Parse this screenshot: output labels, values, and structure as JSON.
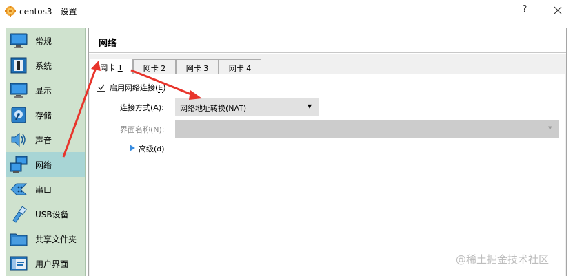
{
  "window": {
    "title": "centos3 - 设置",
    "help_label": "?",
    "app_icon": "virtualbox-gear-icon",
    "close_icon": "close-icon"
  },
  "sidebar": {
    "items": [
      {
        "label": "常规",
        "icon": "general-monitor-icon",
        "active": false
      },
      {
        "label": "系统",
        "icon": "system-chip-icon",
        "active": false
      },
      {
        "label": "显示",
        "icon": "display-monitor-icon",
        "active": false
      },
      {
        "label": "存储",
        "icon": "storage-disk-icon",
        "active": false
      },
      {
        "label": "声音",
        "icon": "speaker-icon",
        "active": false
      },
      {
        "label": "网络",
        "icon": "network-icon",
        "active": true
      },
      {
        "label": "串口",
        "icon": "serial-port-icon",
        "active": false
      },
      {
        "label": "USB设备",
        "icon": "usb-icon",
        "active": false
      },
      {
        "label": "共享文件夹",
        "icon": "shared-folder-icon",
        "active": false
      },
      {
        "label": "用户界面",
        "icon": "user-interface-icon",
        "active": false
      }
    ]
  },
  "main": {
    "title": "网络",
    "tabs": [
      {
        "label": "网卡",
        "num": "1",
        "active": true
      },
      {
        "label": "网卡",
        "num": "2",
        "active": false
      },
      {
        "label": "网卡",
        "num": "3",
        "active": false
      },
      {
        "label": "网卡",
        "num": "4",
        "active": false
      }
    ],
    "enable_checkbox": {
      "label_prefix": "启用网络连接(",
      "mnemonic": "E",
      "label_suffix": ")",
      "checked": true
    },
    "attach_label": "连接方式(A):",
    "attach_value": "网络地址转换(NAT)",
    "name_label": "界面名称(N):",
    "name_value": "",
    "advanced_label": "高级(d)"
  },
  "watermark": "@稀土掘金技术社区",
  "colors": {
    "sidebar_bg": "#cfe2ce",
    "sidebar_active": "#a8d5d5",
    "annotation_arrow": "#e8352c",
    "icon_blue": "#1f6fb5"
  }
}
